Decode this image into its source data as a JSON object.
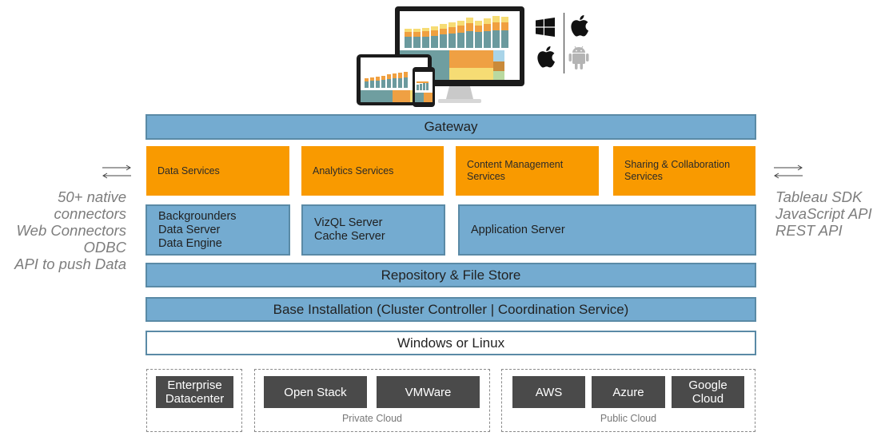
{
  "devices": {
    "description": "desktop, tablet and phone dashboards",
    "platform_icons": [
      "windows-icon",
      "apple-icon",
      "apple-icon",
      "android-icon"
    ]
  },
  "gateway": {
    "label": "Gateway"
  },
  "services": [
    {
      "label": "Data Services"
    },
    {
      "label": "Analytics Services"
    },
    {
      "label": "Content Management\nServices"
    },
    {
      "label": "Sharing & Collaboration\nServices"
    }
  ],
  "servers": [
    {
      "lines": [
        "Backgrounders",
        "Data Server",
        "Data Engine"
      ]
    },
    {
      "lines": [
        "VizQL Server",
        "Cache Server"
      ]
    },
    {
      "lines": [
        "Application Server"
      ]
    }
  ],
  "repository": {
    "label": "Repository & File Store"
  },
  "base_installation": {
    "label": "Base Installation (Cluster Controller | Coordination Service)"
  },
  "os": {
    "label": "Windows or Linux"
  },
  "deployment": {
    "enterprise": {
      "items": [
        "Enterprise\nDatacenter"
      ]
    },
    "private_cloud": {
      "label": "Private Cloud",
      "items": [
        "Open Stack",
        "VMWare"
      ]
    },
    "public_cloud": {
      "label": "Public Cloud",
      "items": [
        "AWS",
        "Azure",
        "Google\nCloud"
      ]
    }
  },
  "left_side": {
    "lines": [
      "50+ native",
      "connectors",
      "Web Connectors",
      "ODBC",
      "API to push Data"
    ]
  },
  "right_side": {
    "lines": [
      "Tableau SDK",
      "JavaScript API",
      "REST API"
    ]
  },
  "colors": {
    "layer_blue": "#74abd0",
    "service_orange": "#f99a00",
    "deployment_dark": "#4a4a4a"
  }
}
